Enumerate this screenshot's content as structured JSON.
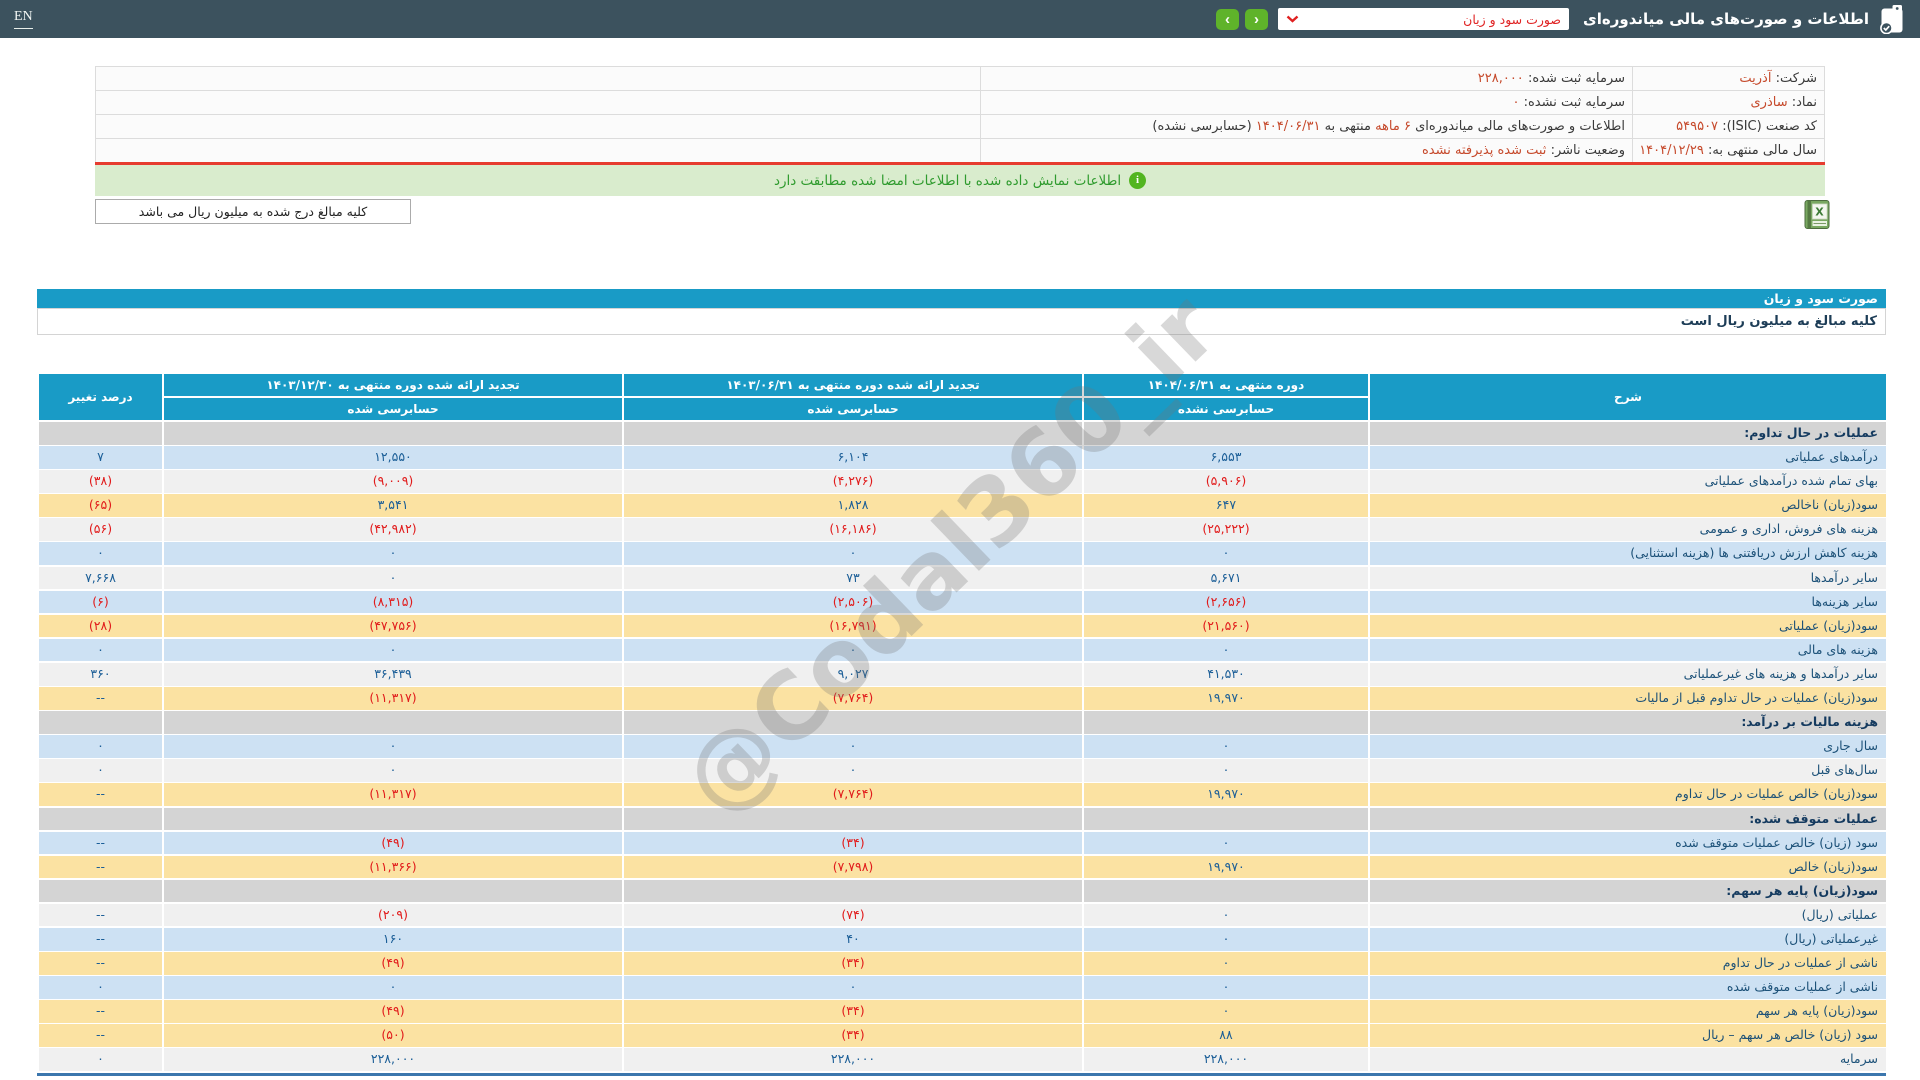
{
  "header": {
    "en_label": "EN",
    "title": "اطلاعات و صورت‌های مالی میاندوره‌ای",
    "dropdown_value": "صورت سود و زیان",
    "next_label": "›",
    "prev_label": "‹"
  },
  "info": {
    "company_label": "شرکت:",
    "company_value": "آذریت",
    "symbol_label": "نماد:",
    "symbol_value": "ساذری",
    "isic_label": "کد صنعت (ISIC):",
    "isic_value": "۵۴۹۵۰۷",
    "fiscal_label": "سال مالی منتهی به:",
    "fiscal_value": "۱۴۰۴/۱۲/۲۹",
    "capital_reg_label": "سرمایه ثبت شده:",
    "capital_reg_value": "۲۲۸,۰۰۰",
    "capital_unreg_label": "سرمایه ثبت نشده:",
    "capital_unreg_value": "۰",
    "period_prefix": "اطلاعات و صورت‌های مالی میاندوره‌ای",
    "period_months": "۶ ماهه",
    "period_mid": "منتهی به",
    "period_date": "۱۴۰۴/۰۶/۳۱",
    "period_suffix": "(حسابرسی نشده)",
    "status_label": "وضعیت ناشر:",
    "status_value": "ثبت شده پذیرفته نشده"
  },
  "banner": {
    "text": "اطلاعات نمایش داده شده با اطلاعات امضا شده مطابقت دارد",
    "icon": "i"
  },
  "unit_note": "کلیه مبالغ درج شده به میلیون ریال می باشد",
  "statement": {
    "title": "صورت سود و زیان",
    "subtitle": "کلیه مبالغ به میلیون ریال است",
    "watermark": "@Codal360_ir",
    "columns": {
      "desc": "شرح",
      "p1_title": "دوره منتهی به ۱۴۰۴/۰۶/۳۱",
      "p1_sub": "حسابرسی نشده",
      "p2_title": "تجدید ارائه شده دوره منتهی به ۱۴۰۳/۰۶/۳۱",
      "p2_sub": "حسابرسی شده",
      "p3_title": "تجدید ارائه شده دوره منتهی به ۱۴۰۳/۱۲/۳۰",
      "p3_sub": "حسابرسی شده",
      "change": "درصد تغییر"
    },
    "rows": [
      {
        "type": "section",
        "label": "عملیات در حال تداوم:"
      },
      {
        "type": "data",
        "variant": "blue",
        "label": "درآمدهای عملیاتی",
        "v1": "۶,۵۵۳",
        "v2": "۶,۱۰۴",
        "v3": "۱۲,۵۵۰",
        "chg": "۷"
      },
      {
        "type": "data",
        "variant": "white",
        "label": "بهای تمام شده درآمدهای عملیاتی",
        "v1": "(۵,۹۰۶)",
        "v2": "(۴,۲۷۶)",
        "v3": "(۹,۰۰۹)",
        "chg": "(۳۸)"
      },
      {
        "type": "data",
        "variant": "yellow",
        "label": "سود(زیان) ناخالص",
        "v1": "۶۴۷",
        "v2": "۱,۸۲۸",
        "v3": "۳,۵۴۱",
        "chg": "(۶۵)"
      },
      {
        "type": "data",
        "variant": "white",
        "label": "هزینه های فروش، اداری و عمومی",
        "v1": "(۲۵,۲۲۲)",
        "v2": "(۱۶,۱۸۶)",
        "v3": "(۴۲,۹۸۲)",
        "chg": "(۵۶)"
      },
      {
        "type": "data",
        "variant": "blue",
        "label": "هزینه کاهش ارزش دریافتنی ها (هزینه استثنایی)",
        "v1": "۰",
        "v2": "۰",
        "v3": "۰",
        "chg": "۰"
      },
      {
        "type": "data",
        "variant": "white",
        "label": "سایر درآمدها",
        "v1": "۵,۶۷۱",
        "v2": "۷۳",
        "v3": "۰",
        "chg": "۷,۶۶۸"
      },
      {
        "type": "data",
        "variant": "blue",
        "label": "سایر هزینه‌ها",
        "v1": "(۲,۶۵۶)",
        "v2": "(۲,۵۰۶)",
        "v3": "(۸,۳۱۵)",
        "chg": "(۶)"
      },
      {
        "type": "data",
        "variant": "yellow",
        "label": "سود(زیان) عملیاتی",
        "v1": "(۲۱,۵۶۰)",
        "v2": "(۱۶,۷۹۱)",
        "v3": "(۴۷,۷۵۶)",
        "chg": "(۲۸)"
      },
      {
        "type": "data",
        "variant": "blue",
        "label": "هزینه های مالی",
        "v1": "۰",
        "v2": "۰",
        "v3": "۰",
        "chg": "۰"
      },
      {
        "type": "data",
        "variant": "white",
        "label": "سایر درآمدها و هزینه های غیرعملیاتی",
        "v1": "۴۱,۵۳۰",
        "v2": "۹,۰۲۷",
        "v3": "۳۶,۴۳۹",
        "chg": "۳۶۰"
      },
      {
        "type": "data",
        "variant": "yellow",
        "label": "سود(زیان) عملیات در حال تداوم قبل از مالیات",
        "v1": "۱۹,۹۷۰",
        "v2": "(۷,۷۶۴)",
        "v3": "(۱۱,۳۱۷)",
        "chg": "--"
      },
      {
        "type": "section",
        "label": "هزینه مالیات بر درآمد:"
      },
      {
        "type": "data",
        "variant": "blue",
        "label": "سال جاری",
        "v1": "۰",
        "v2": "۰",
        "v3": "۰",
        "chg": "۰"
      },
      {
        "type": "data",
        "variant": "white",
        "label": "سال‌های قبل",
        "v1": "۰",
        "v2": "۰",
        "v3": "۰",
        "chg": "۰"
      },
      {
        "type": "data",
        "variant": "yellow",
        "label": "سود(زیان) خالص عملیات در حال تداوم",
        "v1": "۱۹,۹۷۰",
        "v2": "(۷,۷۶۴)",
        "v3": "(۱۱,۳۱۷)",
        "chg": "--"
      },
      {
        "type": "section",
        "label": "عملیات متوقف شده:"
      },
      {
        "type": "data",
        "variant": "blue",
        "label": "سود (زیان) خالص عملیات متوقف شده",
        "v1": "۰",
        "v2": "(۳۴)",
        "v3": "(۴۹)",
        "chg": "--"
      },
      {
        "type": "data",
        "variant": "yellow",
        "label": "سود(زیان) خالص",
        "v1": "۱۹,۹۷۰",
        "v2": "(۷,۷۹۸)",
        "v3": "(۱۱,۳۶۶)",
        "chg": "--"
      },
      {
        "type": "section",
        "label": "سود(زیان) پایه هر سهم:"
      },
      {
        "type": "data",
        "variant": "white",
        "label": "عملیاتی (ریال)",
        "v1": "۰",
        "v2": "(۷۴)",
        "v3": "(۲۰۹)",
        "chg": "--"
      },
      {
        "type": "data",
        "variant": "blue",
        "label": "غیرعملیاتی (ریال)",
        "v1": "۰",
        "v2": "۴۰",
        "v3": "۱۶۰",
        "chg": "--"
      },
      {
        "type": "data",
        "variant": "yellow",
        "label": "ناشی از عملیات در حال تداوم",
        "v1": "۰",
        "v2": "(۳۴)",
        "v3": "(۴۹)",
        "chg": "--"
      },
      {
        "type": "data",
        "variant": "blue",
        "label": "ناشی از عملیات متوقف شده",
        "v1": "۰",
        "v2": "۰",
        "v3": "۰",
        "chg": "۰"
      },
      {
        "type": "data",
        "variant": "yellow",
        "label": "سود(زیان) پایه هر سهم",
        "v1": "۰",
        "v2": "(۳۴)",
        "v3": "(۴۹)",
        "chg": "--"
      },
      {
        "type": "data",
        "variant": "yellow",
        "label": "سود (زیان) خالص هر سهم – ریال",
        "v1": "۸۸",
        "v2": "(۳۴)",
        "v3": "(۵۰)",
        "chg": "--"
      },
      {
        "type": "data",
        "variant": "white",
        "label": "سرمایه",
        "v1": "۲۲۸,۰۰۰",
        "v2": "۲۲۸,۰۰۰",
        "v3": "۲۲۸,۰۰۰",
        "chg": "۰"
      }
    ]
  },
  "colors": {
    "topbar": "#3c525e",
    "teal_header": "#199bc6",
    "button_green": "#5fb32a",
    "row_blue": "#cde1f3",
    "row_yellow": "#fbe2a2",
    "row_section": "#d4d4d4",
    "row_white": "#f0f0f0",
    "negative": "#e11b1b",
    "positive": "#1b5e97",
    "value_red": "#c64a2c",
    "banner_bg": "#d9eccd",
    "banner_text": "#2f9b2e",
    "red_line": "#e63c2f"
  }
}
